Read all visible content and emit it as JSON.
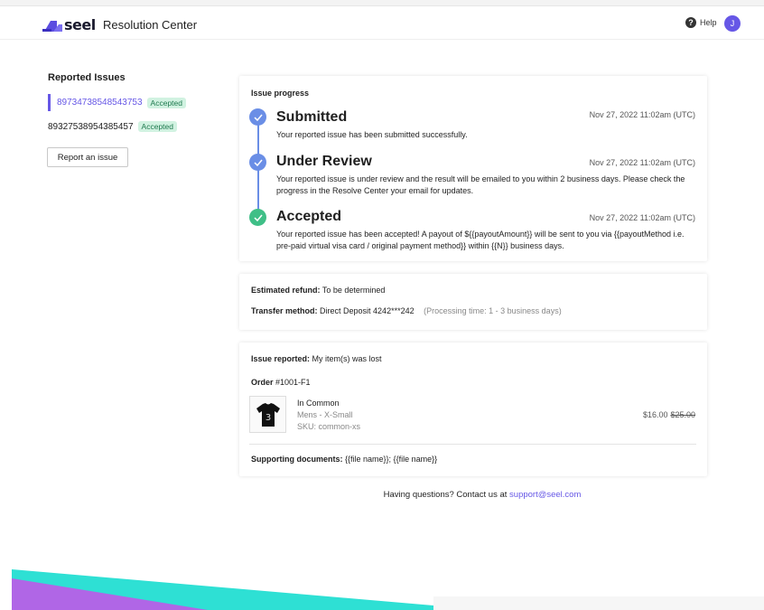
{
  "header": {
    "logo_text": "seel",
    "app_title": "Resolution Center",
    "help_label": "Help",
    "avatar_initial": "J"
  },
  "sidebar": {
    "title": "Reported Issues",
    "issues": [
      {
        "id": "897347385485437​53",
        "status": "Accepted"
      },
      {
        "id": "89327538954385457",
        "status": "Accepted"
      }
    ],
    "report_button": "Report an issue"
  },
  "progress": {
    "label": "Issue progress",
    "steps": [
      {
        "title": "Submitted",
        "date": "Nov 27, 2022  11:02am (UTC)",
        "description": "Your reported issue has been submitted successfully.",
        "icon": "check-icon",
        "color": "#6a8ee6"
      },
      {
        "title": "Under Review",
        "date": "Nov 27, 2022  11:02am (UTC)",
        "description": "Your reported issue is under review and the result will be emailed to you within 2 business days. Please check the progress in the Resolve Center your email for updates.",
        "icon": "check-icon",
        "color": "#6a8ee6"
      },
      {
        "title": "Accepted",
        "date": "Nov 27, 2022  11:02am (UTC)",
        "description": "Your reported issue has been accepted! A payout of ${{payoutAmount}} will be sent to you via {{payoutMethod i.e. pre-paid virtual visa card / original payment method}} within {{N}} business days.",
        "icon": "check-icon",
        "color": "#3fbf87"
      }
    ]
  },
  "refund": {
    "estimated_label": "Estimated refund:",
    "estimated_value": "To be determined",
    "transfer_label": "Transfer method:",
    "transfer_value": "Direct Deposit  4242***242",
    "processing_note": "(Processing time: 1 - 3 business days)"
  },
  "order": {
    "issue_label": "Issue reported:",
    "issue_value": "My item(s) was lost",
    "order_label": "Order",
    "order_number": "#1001-F1",
    "product": {
      "name": "In Common",
      "variant": "Mens - X-Small",
      "sku": "SKU: common-xs",
      "price": "$16.00",
      "original_price": "$25.00",
      "image_icon": "tshirt-icon"
    },
    "docs_label": "Supporting documents:",
    "docs_value": "{{file name}};  {{file name}}"
  },
  "footer": {
    "contact_text": "Having questions? Contact us at",
    "contact_email": "support@seel.com"
  },
  "colors": {
    "accent": "#6657e6",
    "timeline": "#6a8ee6",
    "accepted": "#3fbf87",
    "badge_bg": "#d1f2e1",
    "decor_teal": "#2ee0d4",
    "decor_purple": "#b066e6"
  }
}
